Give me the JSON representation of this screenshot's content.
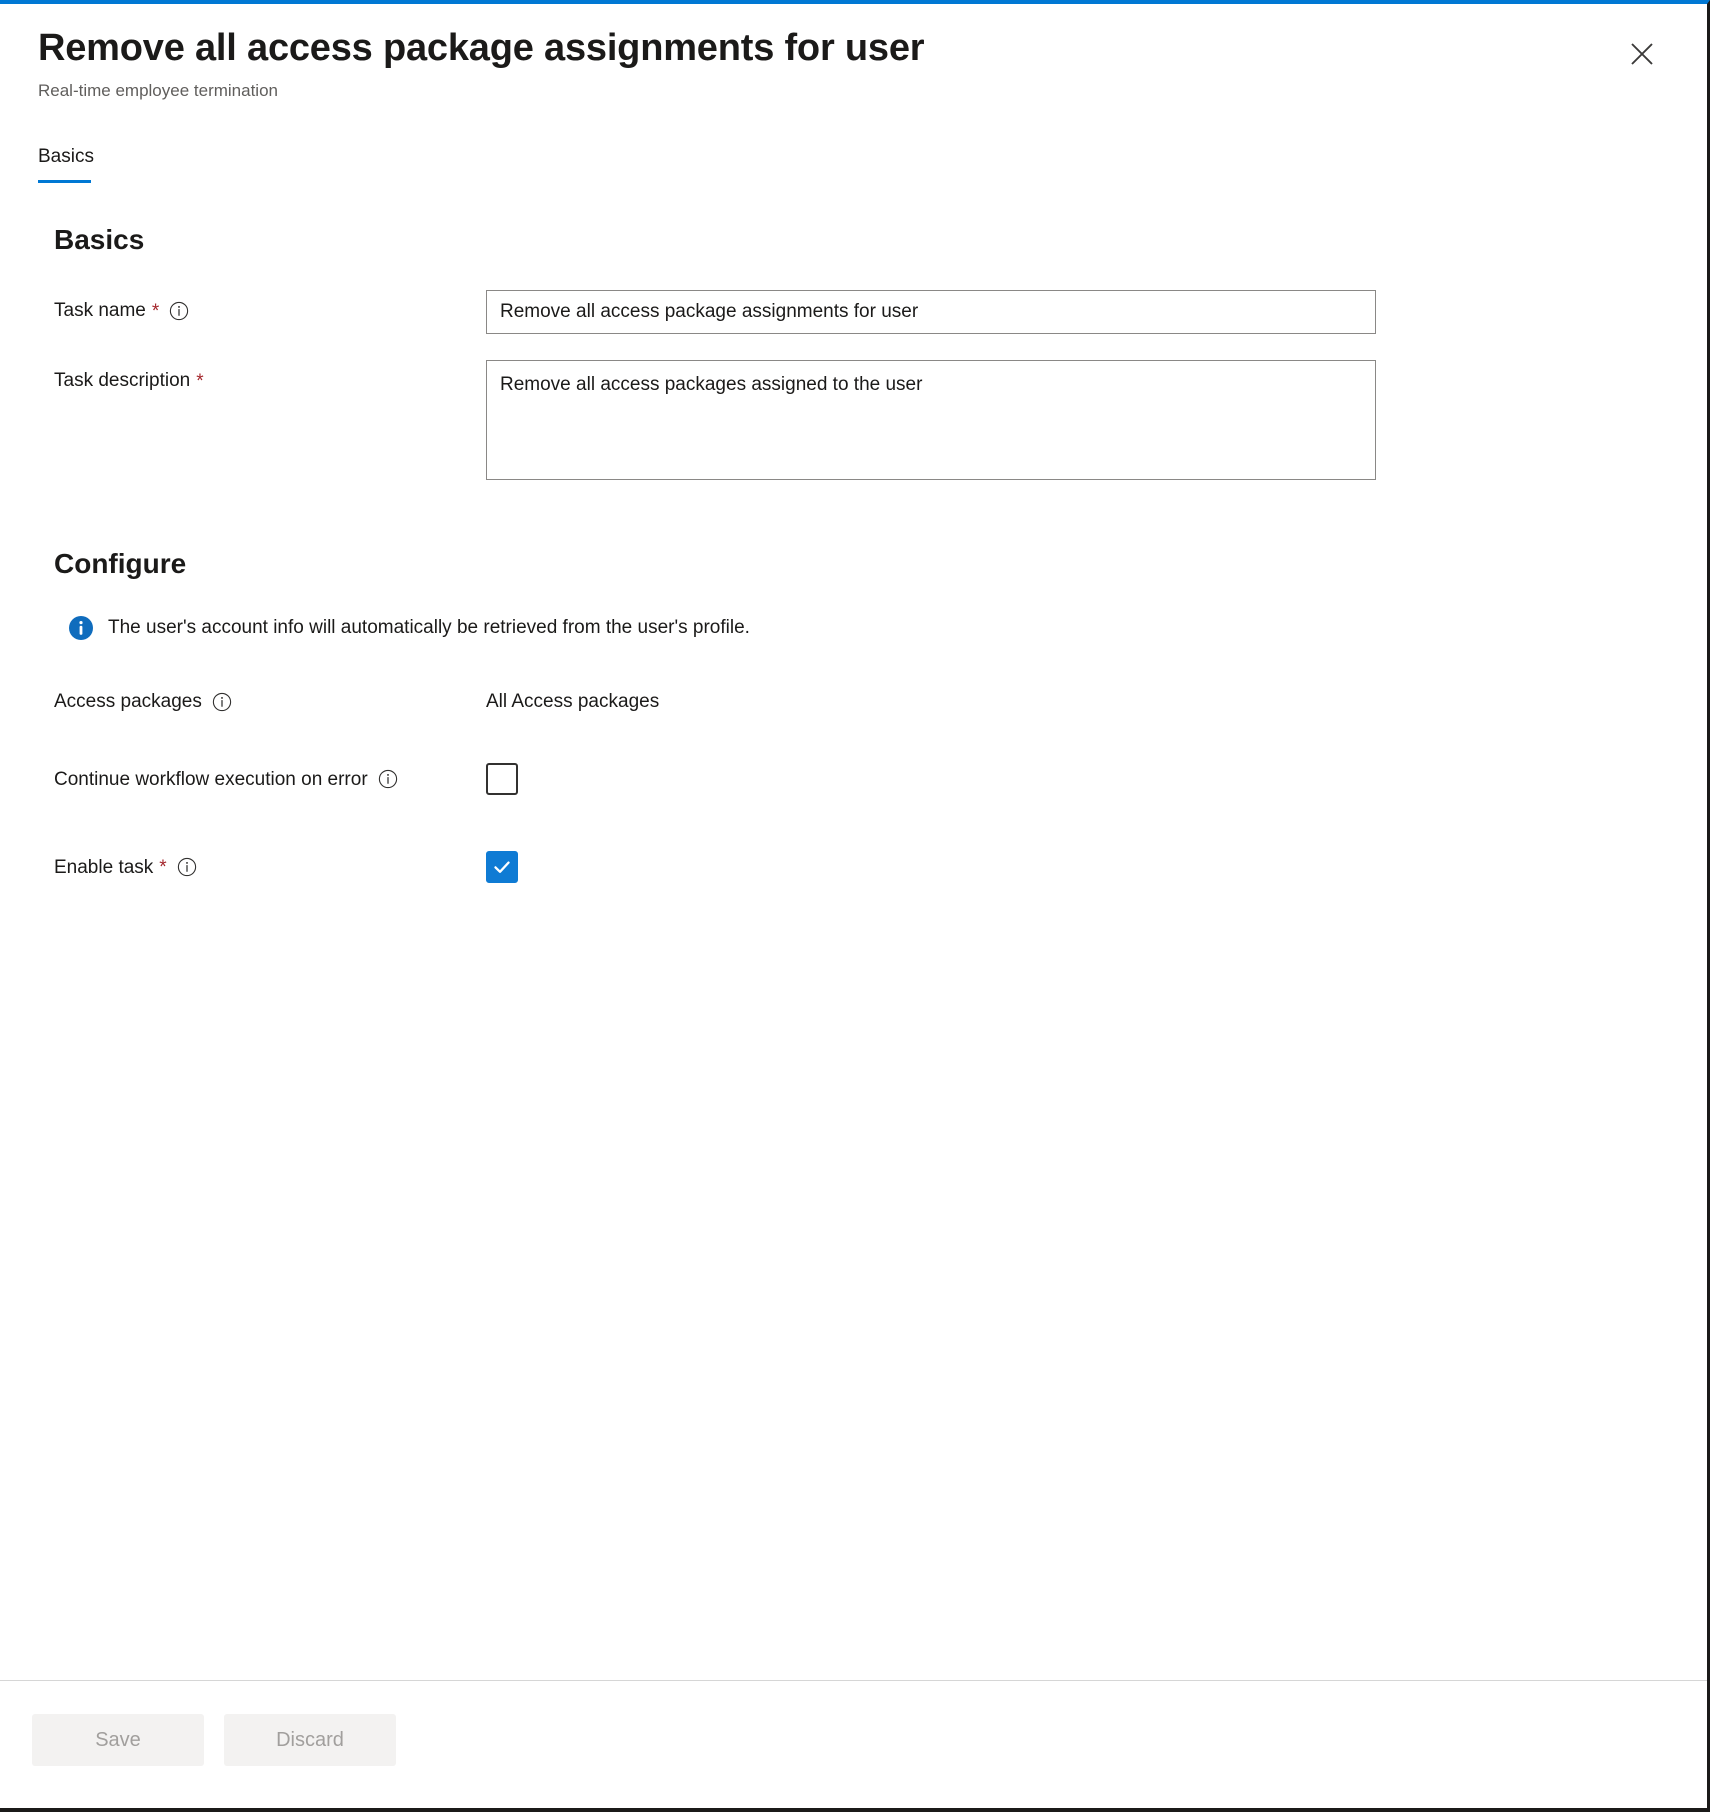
{
  "blade": {
    "title": "Remove all access package assignments for user",
    "subtitle": "Real-time employee termination",
    "close_label": "Close",
    "accent_color": "#0078d4"
  },
  "tabs": [
    {
      "label": "Basics",
      "selected": true
    }
  ],
  "sections": {
    "basics": {
      "heading": "Basics",
      "task_name": {
        "label": "Task name",
        "required_marker": "*",
        "info_icon": "info-icon",
        "value": "Remove all access package assignments for user",
        "placeholder": ""
      },
      "task_description": {
        "label": "Task description",
        "required_marker": "*",
        "value": "Remove all access packages assigned to the user",
        "placeholder": ""
      }
    },
    "configure": {
      "heading": "Configure",
      "info_banner": {
        "icon": "info-filled-icon",
        "text": "The user's account info will automatically be retrieved from the user's profile.",
        "color": "#0f6cbd"
      },
      "access_packages": {
        "label": "Access packages",
        "info_icon": "info-icon",
        "value": "All Access packages"
      },
      "continue_on_error": {
        "label": "Continue workflow execution on error",
        "info_icon": "info-icon",
        "checked": false
      },
      "enable_task": {
        "label": "Enable task",
        "required_marker": "*",
        "info_icon": "info-icon",
        "checked": true,
        "checked_color": "#0f7bd4"
      }
    }
  },
  "footer": {
    "save_label": "Save",
    "discard_label": "Discard",
    "save_enabled": false,
    "discard_enabled": false
  }
}
